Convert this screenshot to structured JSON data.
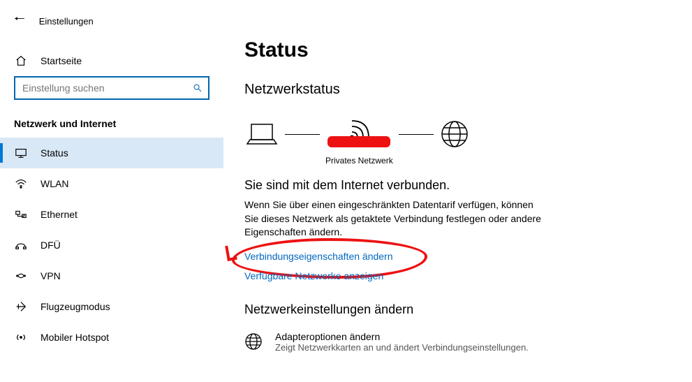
{
  "header": {
    "app_title": "Einstellungen"
  },
  "sidebar": {
    "home_label": "Startseite",
    "search_placeholder": "Einstellung suchen",
    "section_title": "Netzwerk und Internet",
    "items": [
      {
        "label": "Status"
      },
      {
        "label": "WLAN"
      },
      {
        "label": "Ethernet"
      },
      {
        "label": "DFÜ"
      },
      {
        "label": "VPN"
      },
      {
        "label": "Flugzeugmodus"
      },
      {
        "label": "Mobiler Hotspot"
      }
    ]
  },
  "main": {
    "page_title": "Status",
    "network_status_title": "Netzwerkstatus",
    "priv_net": "Privates Netzwerk",
    "connected_title": "Sie sind mit dem Internet verbunden.",
    "connected_desc": "Wenn Sie über einen eingeschränkten Datentarif verfügen, können Sie dieses Netzwerk als getaktete Verbindung festlegen oder andere Eigenschaften ändern.",
    "link_props": "Verbindungseigenschaften ändern",
    "link_networks": "Verfügbare Netzwerke anzeigen",
    "change_title": "Netzwerkeinstellungen ändern",
    "adapter_title": "Adapteroptionen ändern",
    "adapter_desc": "Zeigt Netzwerkkarten an und ändert Verbindungseinstellungen."
  }
}
